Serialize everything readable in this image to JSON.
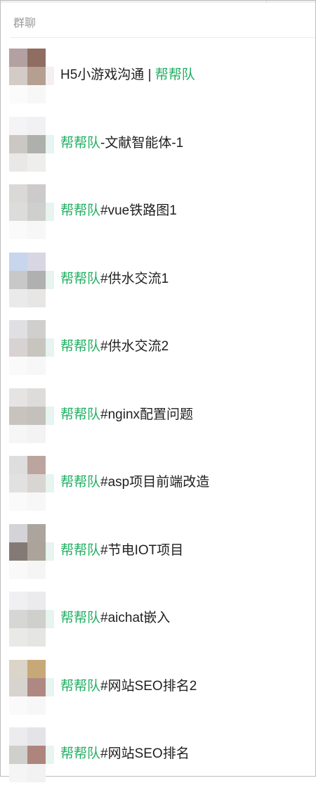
{
  "panel": {
    "title": "群聊",
    "accent_color": "#1fae61"
  },
  "groups": [
    {
      "prefix": "H5小游戏沟通 | ",
      "team": "帮帮队",
      "suffix": "",
      "avatar_colors": [
        "#b3a1a2",
        "#8f6d61",
        "#d2cbc7",
        "#b59f91",
        "#fcfbfb",
        "#f7f7f7",
        "#f5efef"
      ]
    },
    {
      "prefix": "",
      "team": "帮帮队",
      "suffix": "-文献智能体-1",
      "avatar_colors": [
        "#f4f4f6",
        "#f1f1f3",
        "#cbc8c4",
        "#adb0ab",
        "#e9e8e7",
        "#eeeeec",
        "#e7f4ef"
      ]
    },
    {
      "prefix": "",
      "team": "帮帮队",
      "suffix": "#vue铁路图1",
      "avatar_colors": [
        "#dad9d8",
        "#cccaca",
        "#dcdcda",
        "#cfcfce",
        "#fafafa",
        "#f7f7f7",
        "#e7f4ef"
      ]
    },
    {
      "prefix": "",
      "team": "帮帮队",
      "suffix": "#供水交流1",
      "avatar_colors": [
        "#c7d6ec",
        "#d8d6e3",
        "#c9c8c8",
        "#b0b0b1",
        "#ebeaea",
        "#e7e6e5",
        "#e7f4ef"
      ]
    },
    {
      "prefix": "",
      "team": "帮帮队",
      "suffix": "#供水交流2",
      "avatar_colors": [
        "#e0e0e2",
        "#d0cfcd",
        "#d9d2d2",
        "#c8c5bf",
        "#fafafa",
        "#f7f7f7",
        "#e7f4ef"
      ]
    },
    {
      "prefix": "",
      "team": "帮帮队",
      "suffix": "#nginx配置问题",
      "avatar_colors": [
        "#e5e4e3",
        "#dedcdb",
        "#c9c3be",
        "#c4c0bc",
        "#f6f6f7",
        "#f3f3f4",
        "#e7f4ef"
      ]
    },
    {
      "prefix": "",
      "team": "帮帮队",
      "suffix": "#asp项目前端改造",
      "avatar_colors": [
        "#dedede",
        "#bca59e",
        "#e2e1e1",
        "#d9d5d2",
        "#fafafa",
        "#f7f7f7",
        "#e7f4ef"
      ]
    },
    {
      "prefix": "",
      "team": "帮帮队",
      "suffix": "#节电IOT项目",
      "avatar_colors": [
        "#d4d4d8",
        "#aba59e",
        "#847a75",
        "#aaa49a",
        "#f9f9f9",
        "#f5f5f5",
        "#e7f4ef"
      ]
    },
    {
      "prefix": "",
      "team": "帮帮队",
      "suffix": "#aichat嵌入",
      "avatar_colors": [
        "#f0f0f2",
        "#ebebee",
        "#d6d6d4",
        "#cfcfcc",
        "#e9e9e7",
        "#e5e5e2",
        "#e7f4ef"
      ]
    },
    {
      "prefix": "",
      "team": "帮帮队",
      "suffix": "#网站SEO排名2",
      "avatar_colors": [
        "#dad4c9",
        "#c7a978",
        "#d7d4cf",
        "#b08883",
        "#fafafa",
        "#f7f7f7",
        "#e7f4ef"
      ]
    },
    {
      "prefix": "",
      "team": "帮帮队",
      "suffix": "#网站SEO排名",
      "avatar_colors": [
        "#ececef",
        "#e4e4e8",
        "#cfcfcc",
        "#ae857d",
        "#f5f5f6",
        "#f2f2f3",
        "#e7f4ef"
      ]
    }
  ]
}
